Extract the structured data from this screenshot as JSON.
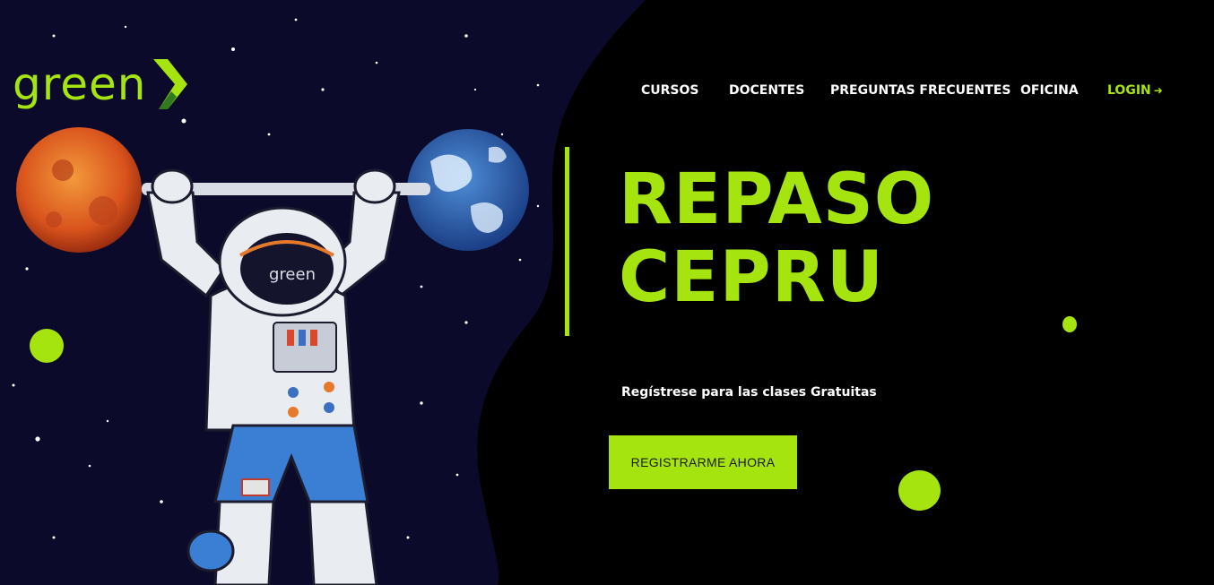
{
  "logo": {
    "text": "green"
  },
  "nav": {
    "cursos": "CURSOS",
    "docentes": "DOCENTES",
    "preguntas": "PREGUNTAS FRECUENTES",
    "oficina": "OFICINA",
    "login": "LOGIN",
    "login_icon": "sign-in-icon"
  },
  "hero": {
    "title_line1": "REPASO",
    "title_line2": "CEPRU",
    "subtitle": "Regístrese para las clases Gratuitas",
    "cta_label": "REGISTRARME AHORA",
    "illustration_text": "green"
  },
  "colors": {
    "accent": "#a6e410",
    "background": "#000000",
    "space": "#0b0a2a"
  }
}
